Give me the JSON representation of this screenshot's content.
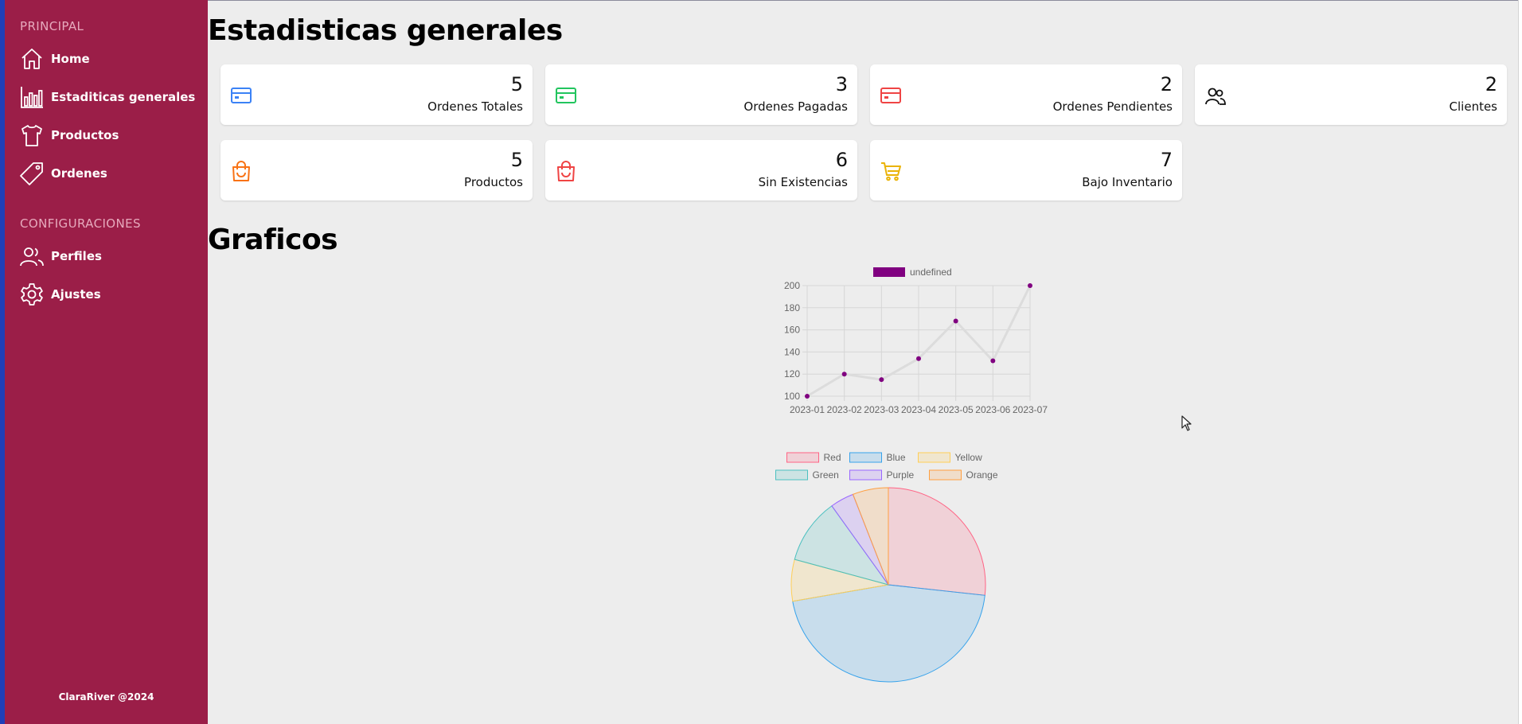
{
  "sidebar": {
    "principal_title": "PRINCIPAL",
    "config_title": "CONFIGURACIONES",
    "items": [
      {
        "label": "Home",
        "icon": "home-icon"
      },
      {
        "label": "Estaditicas generales",
        "icon": "bar-chart-icon"
      },
      {
        "label": "Productos",
        "icon": "shirt-icon"
      },
      {
        "label": "Ordenes",
        "icon": "tag-icon"
      }
    ],
    "config_items": [
      {
        "label": "Perfiles",
        "icon": "users-icon"
      },
      {
        "label": "Ajustes",
        "icon": "gear-icon"
      }
    ],
    "footer": "ClaraRiver @2024"
  },
  "main": {
    "title": "Estadisticas generales",
    "charts_title": "Graficos"
  },
  "cards": [
    {
      "value": "5",
      "label": "Ordenes Totales",
      "icon": "credit-card-icon",
      "color": "#3b82f6"
    },
    {
      "value": "3",
      "label": "Ordenes Pagadas",
      "icon": "credit-card-icon",
      "color": "#22c55e"
    },
    {
      "value": "2",
      "label": "Ordenes Pendientes",
      "icon": "credit-card-icon",
      "color": "#ef4444"
    },
    {
      "value": "2",
      "label": "Clientes",
      "icon": "users-icon",
      "color": "#111111"
    },
    {
      "value": "5",
      "label": "Productos",
      "icon": "shopping-bag-icon",
      "color": "#f97316"
    },
    {
      "value": "6",
      "label": "Sin Existencias",
      "icon": "shopping-bag-icon",
      "color": "#ef4444"
    },
    {
      "value": "7",
      "label": "Bajo Inventario",
      "icon": "cart-icon",
      "color": "#eab308"
    }
  ],
  "chart_data": [
    {
      "type": "line",
      "x": [
        "2023-01",
        "2023-02",
        "2023-03",
        "2023-04",
        "2023-05",
        "2023-06",
        "2023-07"
      ],
      "series": [
        {
          "name": "undefined",
          "values": [
            100,
            120,
            115,
            134,
            168,
            132,
            200
          ]
        }
      ],
      "ylim": [
        100,
        200
      ],
      "yticks": [
        "200",
        "180",
        "160",
        "140",
        "120",
        "100"
      ],
      "grid": true,
      "legend": "top",
      "line_color": "#dcdcdc",
      "point_color": "#800080"
    },
    {
      "type": "pie",
      "categories": [
        "Red",
        "Blue",
        "Yellow",
        "Green",
        "Purple",
        "Orange"
      ],
      "values": [
        27,
        46,
        7,
        11,
        4,
        6
      ],
      "colors": [
        "#ff6384",
        "#36a2eb",
        "#ffce56",
        "#4bc0c0",
        "#9966ff",
        "#ff9f40"
      ],
      "legend": "top"
    }
  ]
}
